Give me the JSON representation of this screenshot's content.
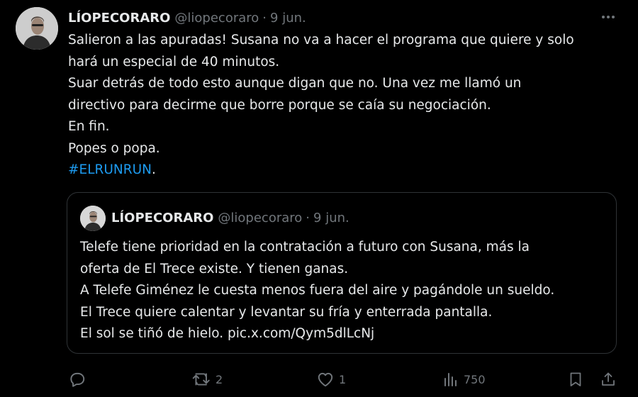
{
  "tweet": {
    "display_name": "LÍOPECORARO",
    "handle": "@liopecoraro",
    "separator": "·",
    "date": "9 jun.",
    "lines": [
      "Salieron a las apuradas! Susana no va a hacer el programa que quiere y solo",
      "hará un especial de 40 minutos.",
      "Suar detrás de todo esto aunque digan que no. Una vez me llamó un",
      "directivo para decirme que borre porque se caía su negociación.",
      "En fin.",
      "Popes o popa."
    ],
    "hashtag": "#ELRUNRUN",
    "hashtag_suffix": "."
  },
  "quote": {
    "display_name": "LÍOPECORARO",
    "handle": "@liopecoraro",
    "separator": "·",
    "date": "9 jun.",
    "lines": [
      "Telefe tiene prioridad en la contratación a futuro con Susana, más la",
      "oferta de El Trece existe. Y tienen ganas.",
      "A Telefe Giménez le cuesta menos fuera del aire y pagándole un sueldo.",
      "El Trece quiere calentar y levantar su fría y enterrada pantalla.",
      "El sol se tiñó de hielo. pic.x.com/Qym5dlLcNj"
    ]
  },
  "actions": {
    "reply_count": "",
    "retweet_count": "2",
    "like_count": "1",
    "views_count": "750"
  },
  "icons": {
    "more": "more-horizontal-icon",
    "reply": "reply-icon",
    "retweet": "retweet-icon",
    "like": "heart-icon",
    "views": "views-icon",
    "bookmark": "bookmark-icon",
    "share": "share-icon"
  },
  "colors": {
    "background": "#000000",
    "text": "#e7e9ea",
    "muted": "#71767b",
    "link": "#1d9bf0",
    "border": "#2f3336"
  }
}
